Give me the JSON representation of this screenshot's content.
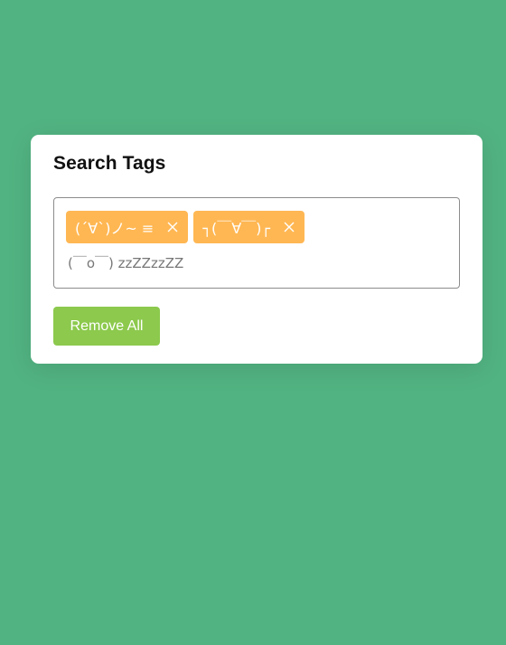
{
  "colors": {
    "background": "#52b382",
    "card": "#ffffff",
    "tag": "#ffb753",
    "button": "#8cc94d"
  },
  "card": {
    "title": "Search Tags"
  },
  "tags": [
    {
      "label": "(´∀`)ノ~ ≡",
      "remove_icon": "close-icon"
    },
    {
      "label": "┐(￣∀￣)┌",
      "remove_icon": "close-icon"
    }
  ],
  "input": {
    "value": "",
    "placeholder": "(￣o￣) zzZZzzZZ"
  },
  "actions": {
    "remove_all_label": "Remove All"
  }
}
